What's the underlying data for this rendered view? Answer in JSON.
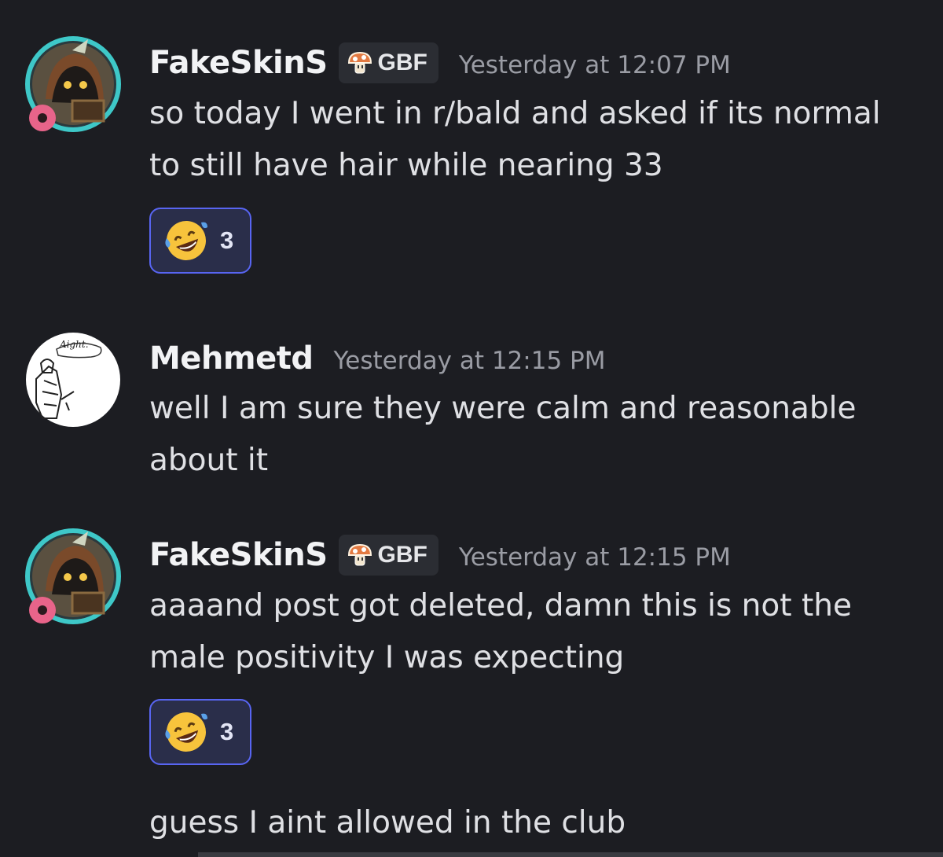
{
  "messages": [
    {
      "username": "FakeSkinS",
      "tag": "GBF",
      "timestamp": "Yesterday at 12:07 PM",
      "lines": [
        "so today I went in r/bald and asked if its  normal",
        "to still have hair while nearing 33"
      ],
      "reaction": {
        "emoji": "rolling-on-floor-laughing",
        "count": "3"
      }
    },
    {
      "username": "Mehmetd",
      "avatar_caption": "Aight.",
      "timestamp": "Yesterday at 12:15 PM",
      "lines": [
        "well I am sure they were calm and reasonable",
        "about it"
      ]
    },
    {
      "username": "FakeSkinS",
      "tag": "GBF",
      "timestamp": "Yesterday at 12:15 PM",
      "lines": [
        "aaaand post got deleted, damn this is not the",
        "male positivity I was expecting"
      ],
      "reaction": {
        "emoji": "rolling-on-floor-laughing",
        "count": "3"
      },
      "followup": "guess I aint allowed in the club"
    }
  ],
  "colors": {
    "background": "#1c1d22",
    "reaction_border": "#5865f2",
    "reaction_bg": "#2a2e4a",
    "timestamp": "#9a9ca4"
  }
}
